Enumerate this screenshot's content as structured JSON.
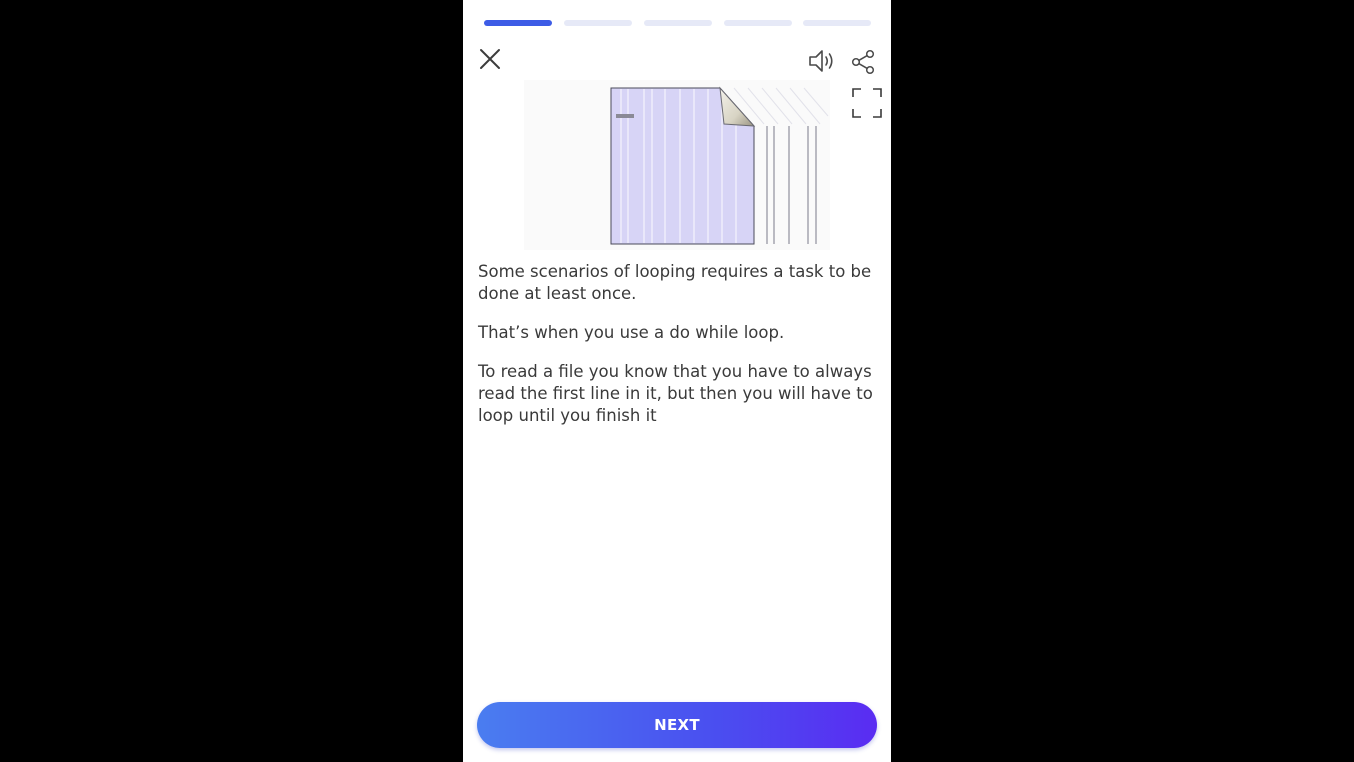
{
  "progress": {
    "segments": 5,
    "active_index": 0
  },
  "icons": {
    "close": "close-icon",
    "sound": "speaker-icon",
    "share": "share-icon",
    "fullscreen": "fullscreen-icon"
  },
  "content": {
    "paragraphs": [
      "Some scenarios of looping requires a task to be done at least once.",
      "That’s when you use a do while loop.",
      "To read a file you know that you have to always read the first line in it, but then you will have to loop until you finish it"
    ]
  },
  "footer": {
    "next_label": "NEXT"
  },
  "colors": {
    "progress_active": "#3d5ce6",
    "progress_inactive": "#e6e9f7",
    "button_gradient_start": "#4a7df0",
    "button_gradient_end": "#5a2cf2",
    "text": "#3a3a3a"
  }
}
